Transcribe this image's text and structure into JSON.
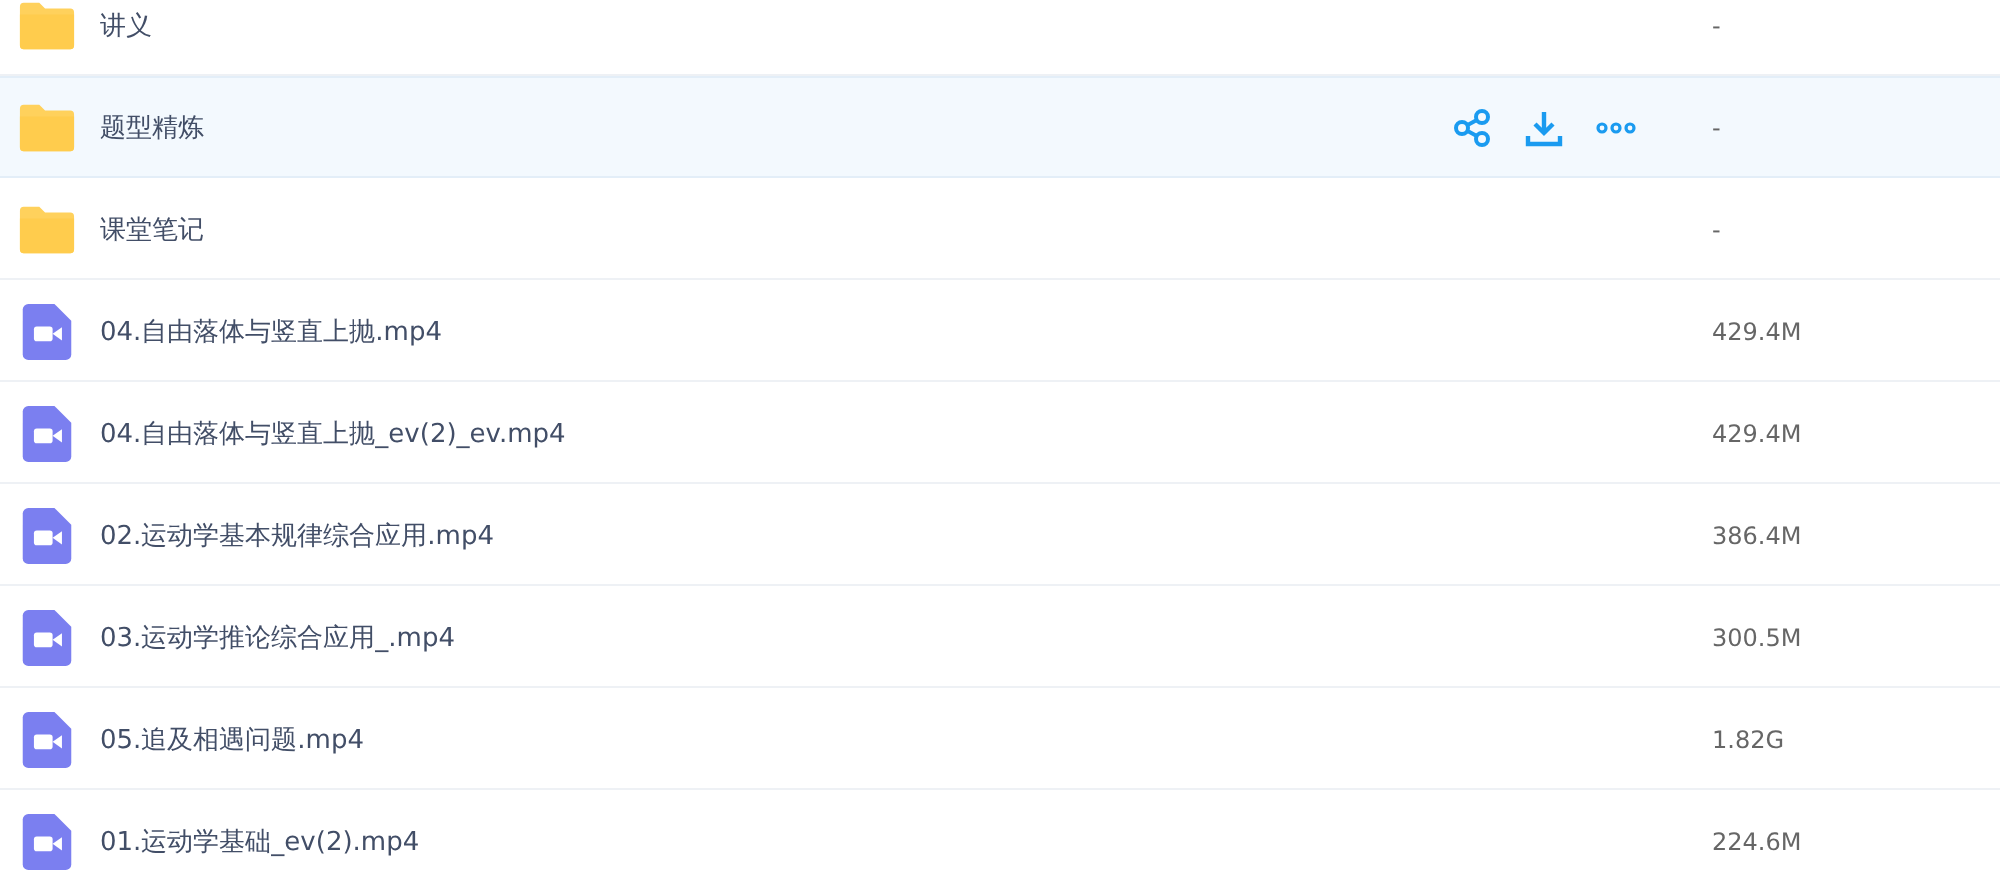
{
  "files": [
    {
      "kind": "folder",
      "name": "讲义",
      "size": "-",
      "selected": false
    },
    {
      "kind": "folder",
      "name": "题型精炼",
      "size": "-",
      "selected": true
    },
    {
      "kind": "folder",
      "name": "课堂笔记",
      "size": "-",
      "selected": false
    },
    {
      "kind": "video",
      "name": "04.自由落体与竖直上抛.mp4",
      "size": "429.4M",
      "selected": false
    },
    {
      "kind": "video",
      "name": "04.自由落体与竖直上抛_ev(2)_ev.mp4",
      "size": "429.4M",
      "selected": false
    },
    {
      "kind": "video",
      "name": "02.运动学基本规律综合应用.mp4",
      "size": "386.4M",
      "selected": false
    },
    {
      "kind": "video",
      "name": "03.运动学推论综合应用_.mp4",
      "size": "300.5M",
      "selected": false
    },
    {
      "kind": "video",
      "name": "05.追及相遇问题.mp4",
      "size": "1.82G",
      "selected": false
    },
    {
      "kind": "video",
      "name": "01.运动学基础_ev(2).mp4",
      "size": "224.6M",
      "selected": false
    }
  ]
}
